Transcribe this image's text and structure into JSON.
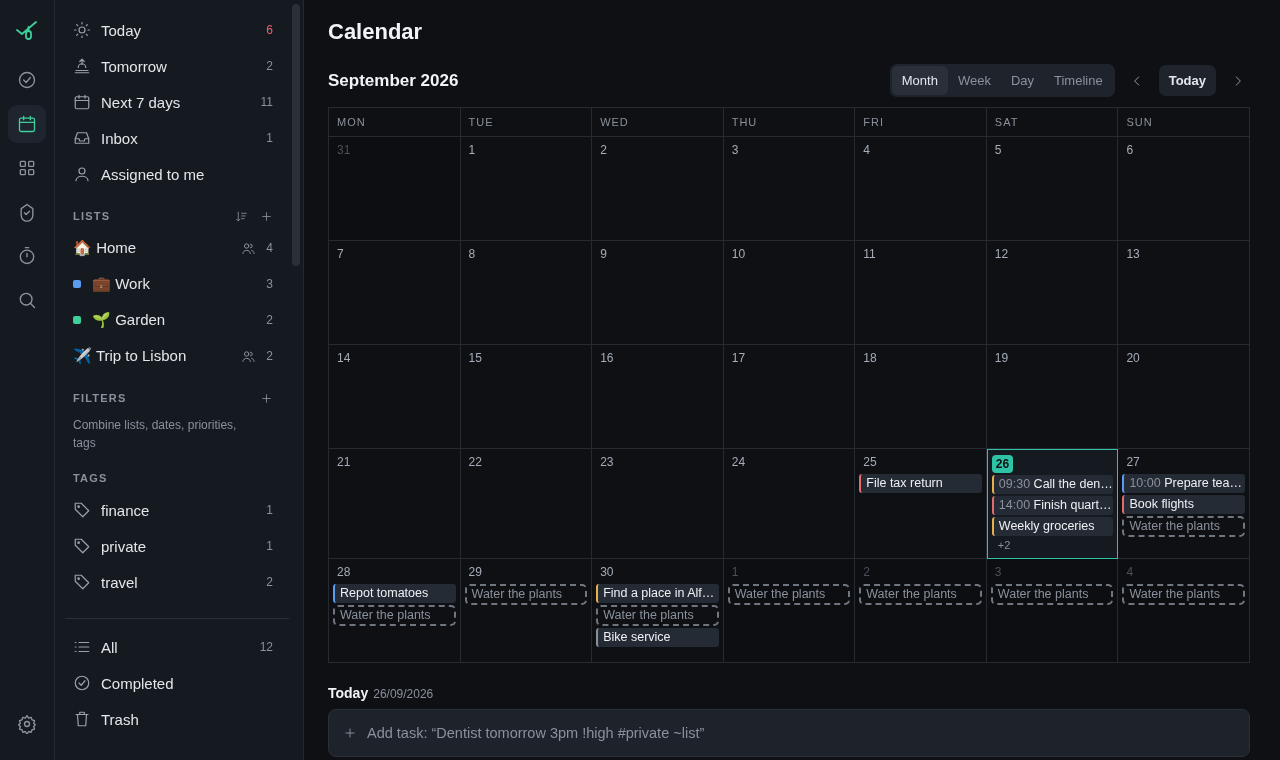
{
  "rail": {
    "items": [
      {
        "kind": "check-circle",
        "selected": false
      },
      {
        "kind": "calendar",
        "selected": true
      },
      {
        "kind": "grid",
        "selected": false
      },
      {
        "kind": "badge-check",
        "selected": false
      },
      {
        "kind": "timer",
        "selected": false
      },
      {
        "kind": "search",
        "selected": false
      }
    ],
    "settings": {
      "kind": "settings"
    }
  },
  "sidebar": {
    "views": [
      {
        "kind": "sun",
        "label": "Today",
        "count": "6",
        "alert": true
      },
      {
        "kind": "sunrise",
        "label": "Tomorrow",
        "count": "2",
        "alert": false
      },
      {
        "kind": "calendar",
        "label": "Next 7 days",
        "count": "11",
        "alert": false
      },
      {
        "kind": "inbox",
        "label": "Inbox",
        "count": "1",
        "alert": false
      },
      {
        "kind": "user",
        "label": "Assigned to me"
      }
    ],
    "lists": {
      "title": "LISTS",
      "items": [
        {
          "label": "🏠 Home",
          "count": "4",
          "shared": true
        },
        {
          "label": "💼 Work",
          "count": "3",
          "shared": false,
          "color": "#5b9cf0"
        },
        {
          "label": "🌱 Garden",
          "count": "2",
          "shared": false,
          "color": "#3ecf9a"
        },
        {
          "label": "✈️ Trip to Lisbon",
          "count": "2",
          "shared": true
        }
      ]
    },
    "filters": {
      "title": "FILTERS",
      "hint": "Combine lists, dates, priorities, tags"
    },
    "tags": {
      "title": "TAGS",
      "items": [
        {
          "label": "finance",
          "count": "1"
        },
        {
          "label": "private",
          "count": "1"
        },
        {
          "label": "travel",
          "count": "2"
        }
      ]
    },
    "footer": [
      {
        "kind": "list",
        "label": "All",
        "count": "12"
      },
      {
        "kind": "check-circle",
        "label": "Completed"
      },
      {
        "kind": "trash",
        "label": "Trash"
      }
    ]
  },
  "main": {
    "title": "Calendar",
    "period": "September 2026",
    "views": [
      {
        "label": "Month",
        "selected": true
      },
      {
        "label": "Week",
        "selected": false
      },
      {
        "label": "Day",
        "selected": false
      },
      {
        "label": "Timeline",
        "selected": false
      }
    ],
    "today_button": "Today",
    "calendar": {
      "weekdays": [
        "MON",
        "TUE",
        "WED",
        "THU",
        "FRI",
        "SAT",
        "SUN"
      ],
      "weeks": [
        {
          "days": [
            {
              "number": "31",
              "muted": true,
              "today": false
            },
            {
              "number": "1",
              "muted": false,
              "today": false
            },
            {
              "number": "2",
              "muted": false,
              "today": false
            },
            {
              "number": "3",
              "muted": false,
              "today": false
            },
            {
              "number": "4",
              "muted": false,
              "today": false
            },
            {
              "number": "5",
              "muted": false,
              "today": false
            },
            {
              "number": "6",
              "muted": false,
              "today": false
            }
          ]
        },
        {
          "days": [
            {
              "number": "7",
              "muted": false,
              "today": false
            },
            {
              "number": "8",
              "muted": false,
              "today": false
            },
            {
              "number": "9",
              "muted": false,
              "today": false
            },
            {
              "number": "10",
              "muted": false,
              "today": false
            },
            {
              "number": "11",
              "muted": false,
              "today": false
            },
            {
              "number": "12",
              "muted": false,
              "today": false
            },
            {
              "number": "13",
              "muted": false,
              "today": false
            }
          ]
        },
        {
          "days": [
            {
              "number": "14",
              "muted": false,
              "today": false
            },
            {
              "number": "15",
              "muted": false,
              "today": false
            },
            {
              "number": "16",
              "muted": false,
              "today": false
            },
            {
              "number": "17",
              "muted": false,
              "today": false
            },
            {
              "number": "18",
              "muted": false,
              "today": false
            },
            {
              "number": "19",
              "muted": false,
              "today": false
            },
            {
              "number": "20",
              "muted": false,
              "today": false
            }
          ]
        },
        {
          "days": [
            {
              "number": "21",
              "muted": false,
              "today": false
            },
            {
              "number": "22",
              "muted": false,
              "today": false
            },
            {
              "number": "23",
              "muted": false,
              "today": false
            },
            {
              "number": "24",
              "muted": false,
              "today": false
            },
            {
              "number": "25",
              "muted": false,
              "today": false,
              "events": [
                {
                  "kind": "task",
                  "title": "File tax return",
                  "color": "#e06c6c"
                }
              ]
            },
            {
              "number": "26",
              "muted": false,
              "today": true,
              "events": [
                {
                  "kind": "task",
                  "time": "09:30",
                  "title": "Call the den…",
                  "color": "#e8b04a"
                },
                {
                  "kind": "task",
                  "time": "14:00",
                  "title": "Finish quart…",
                  "color": "#e06c6c"
                },
                {
                  "kind": "task",
                  "title": "Weekly groceries",
                  "color": "#e8b04a"
                }
              ],
              "more": "+2"
            },
            {
              "number": "27",
              "muted": false,
              "today": false,
              "events": [
                {
                  "kind": "task",
                  "time": "10:00",
                  "title": "Prepare tea…",
                  "color": "#5b9cf0"
                },
                {
                  "kind": "task",
                  "title": "Book flights",
                  "color": "#e06c6c"
                },
                {
                  "kind": "recurring",
                  "title": "Water the plants"
                }
              ]
            }
          ]
        },
        {
          "days": [
            {
              "number": "28",
              "muted": false,
              "today": false,
              "events": [
                {
                  "kind": "task",
                  "title": "Repot tomatoes",
                  "color": "#5b9cf0"
                },
                {
                  "kind": "recurring",
                  "title": "Water the plants"
                }
              ]
            },
            {
              "number": "29",
              "muted": false,
              "today": false,
              "events": [
                {
                  "kind": "recurring",
                  "title": "Water the plants"
                }
              ]
            },
            {
              "number": "30",
              "muted": false,
              "today": false,
              "events": [
                {
                  "kind": "task",
                  "title": "Find a place in Alf…",
                  "color": "#e8b04a"
                },
                {
                  "kind": "recurring",
                  "title": "Water the plants"
                },
                {
                  "kind": "task",
                  "title": "Bike service",
                  "color": "#8a909a"
                }
              ]
            },
            {
              "number": "1",
              "muted": true,
              "today": false,
              "events": [
                {
                  "kind": "recurring",
                  "title": "Water the plants"
                }
              ]
            },
            {
              "number": "2",
              "muted": true,
              "today": false,
              "events": [
                {
                  "kind": "recurring",
                  "title": "Water the plants"
                }
              ]
            },
            {
              "number": "3",
              "muted": true,
              "today": false,
              "events": [
                {
                  "kind": "recurring",
                  "title": "Water the plants"
                }
              ]
            },
            {
              "number": "4",
              "muted": true,
              "today": false,
              "events": [
                {
                  "kind": "recurring",
                  "title": "Water the plants"
                }
              ]
            }
          ]
        }
      ]
    },
    "day_panel": {
      "title": "Today",
      "date": "26/09/2026",
      "add_task": {
        "placeholder": "Add task: “Dentist tomorrow 3pm !high #private ~list”"
      }
    }
  }
}
